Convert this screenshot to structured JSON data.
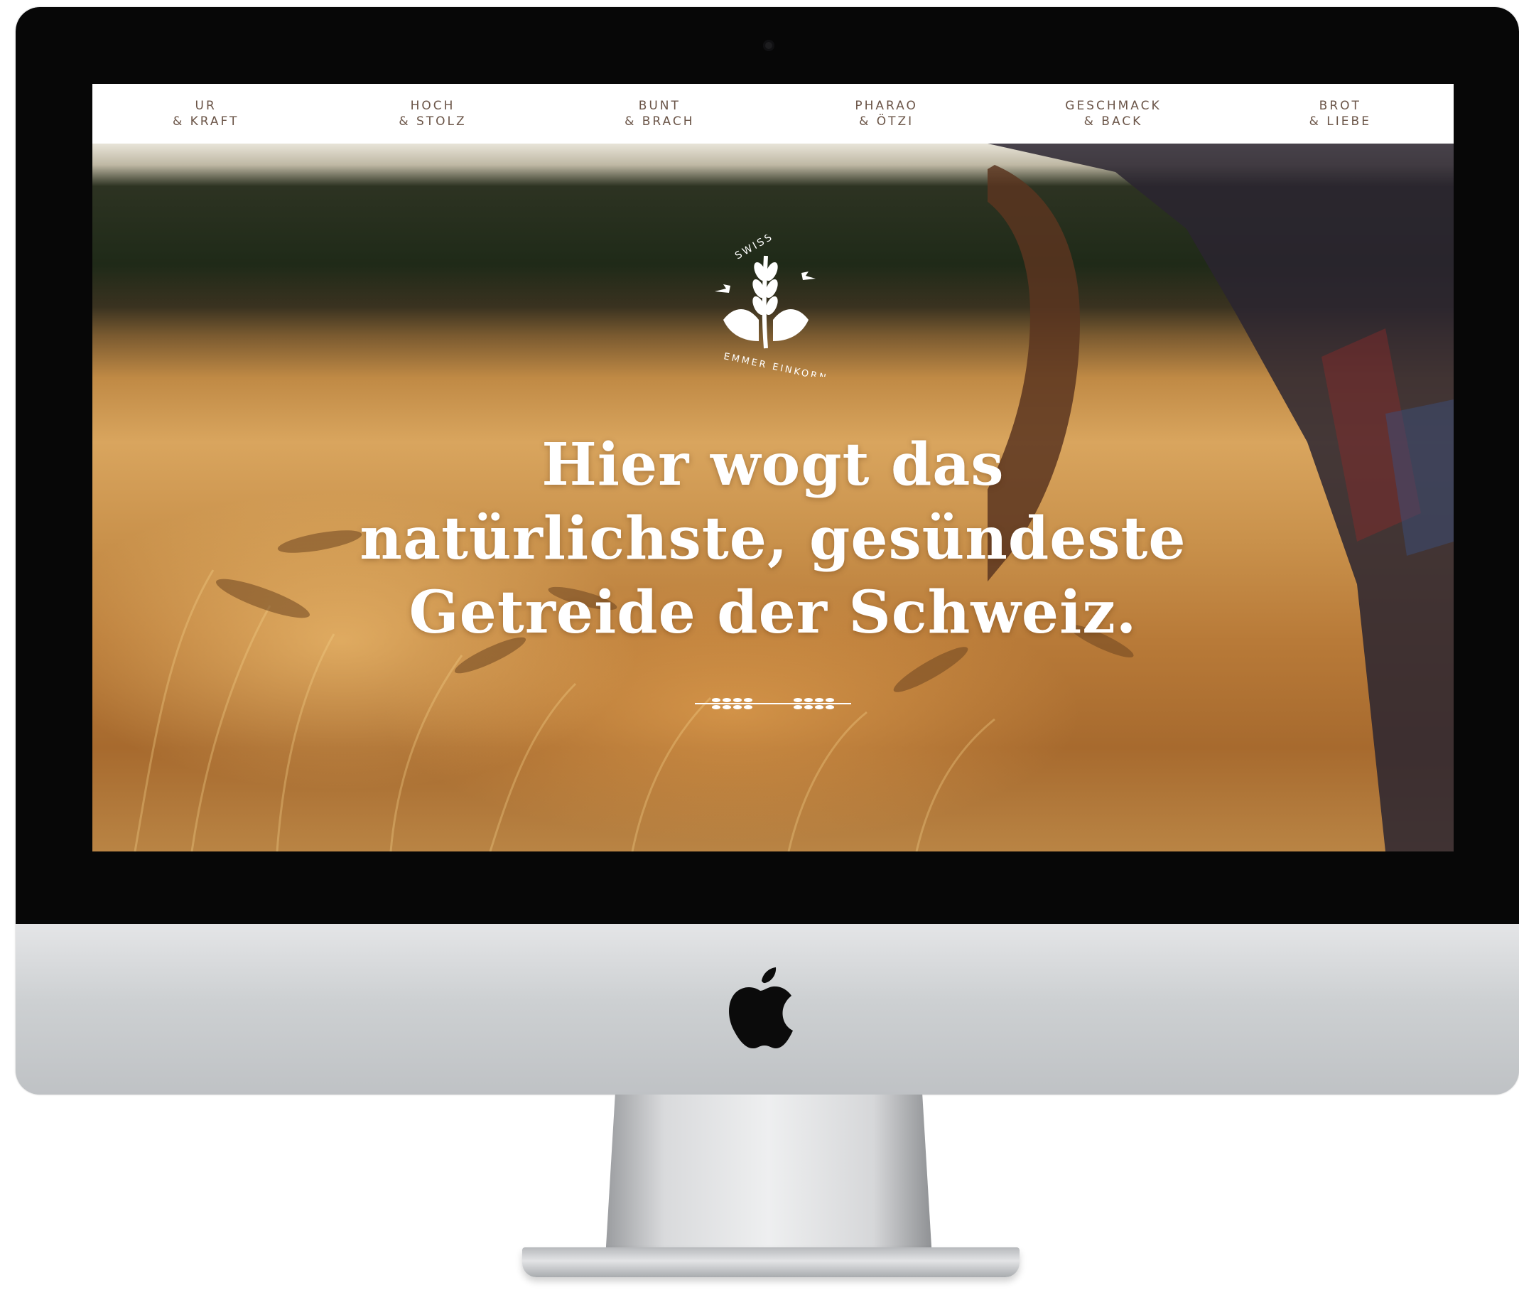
{
  "nav": {
    "items": [
      {
        "line1": "UR",
        "line2": "& KRAFT"
      },
      {
        "line1": "HOCH",
        "line2": "& STOLZ"
      },
      {
        "line1": "BUNT",
        "line2": "& BRACH"
      },
      {
        "line1": "PHARAO",
        "line2": "& ÖTZI"
      },
      {
        "line1": "GESCHMACK",
        "line2": "& BACK"
      },
      {
        "line1": "BROT",
        "line2": "& LIEBE"
      }
    ]
  },
  "logo": {
    "text_top": "SWISS",
    "text_bottom": "EMMER EINKORN"
  },
  "hero": {
    "headline_lines": [
      "Hier wogt das",
      "natürlichste, gesündeste",
      "Getreide der Schweiz."
    ]
  },
  "icons": [
    "camera-icon",
    "apple-logo-icon",
    "wheat-logo-icon",
    "wheat-divider-icon"
  ],
  "colors": {
    "nav_text": "#6b5548",
    "headline": "#ffffff",
    "bezel": "#070707",
    "chin": "#cdd0d2"
  }
}
